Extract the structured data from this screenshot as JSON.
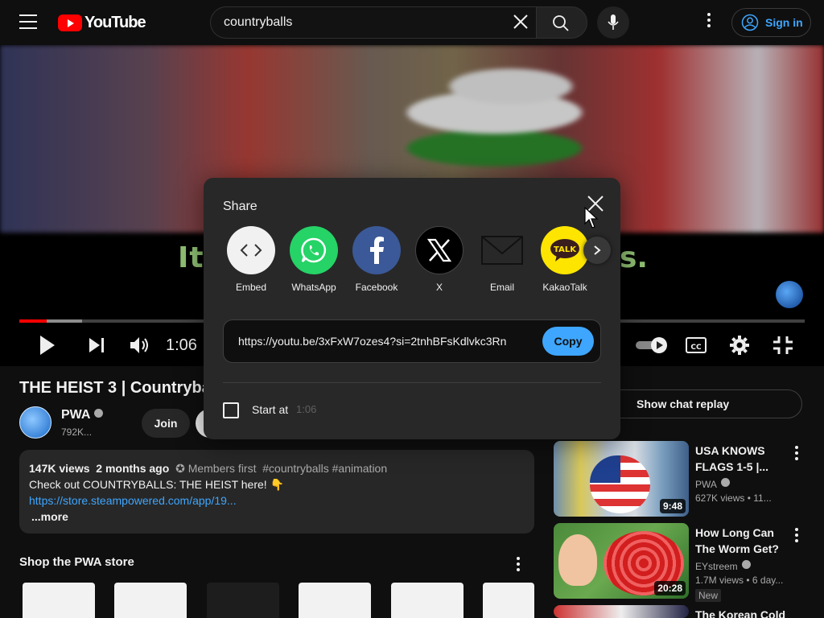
{
  "header": {
    "logo_text": "YouTube",
    "search_value": "countryballs",
    "signin_label": "Sign in"
  },
  "video": {
    "subtitle_left": "It",
    "subtitle_right": "s.",
    "time_current": "1:06",
    "progress_played": 0.035,
    "progress_buffered": 0.08
  },
  "watch": {
    "title": "THE HEIST 3 | Countryballs",
    "channel_name": "PWA",
    "subscriber_count": "792K...",
    "join_label": "Join",
    "description": {
      "views": "147K views",
      "age": "2 months ago",
      "members_label": "✪ Members first",
      "tags": "#countryballs #animation",
      "text": "Check out COUNTRYBALLS: THE HEIST here! 👇",
      "link": "https://store.steampowered.com/app/19...",
      "more_label": "...more"
    },
    "shop_title": "Shop the PWA store"
  },
  "sidebar": {
    "chat_replay_label": "Show chat replay",
    "recommendations": [
      {
        "title": "USA KNOWS FLAGS 1-5 |...",
        "channel": "PWA",
        "meta": "627K views • 11...",
        "duration": "9:48",
        "badge": ""
      },
      {
        "title": "How Long Can The Worm Get?",
        "channel": "EYstreem",
        "meta": "1.7M views • 6 day...",
        "duration": "20:28",
        "badge": "New"
      },
      {
        "title": "The Korean Cold",
        "channel": "",
        "meta": "",
        "duration": "",
        "badge": ""
      }
    ]
  },
  "share": {
    "title": "Share",
    "targets": [
      {
        "label": "Embed",
        "icon": "embed-icon",
        "bg": "#f1f1f1"
      },
      {
        "label": "WhatsApp",
        "icon": "whatsapp-icon",
        "bg": "#25d366"
      },
      {
        "label": "Facebook",
        "icon": "facebook-icon",
        "bg": "#3b5998"
      },
      {
        "label": "X",
        "icon": "x-icon",
        "bg": "#000000"
      },
      {
        "label": "Email",
        "icon": "email-icon",
        "bg": "#282828"
      },
      {
        "label": "KakaoTalk",
        "icon": "kakaotalk-icon",
        "bg": "#fee500"
      }
    ],
    "url": "https://youtu.be/3xFxW7ozes4?si=2tnhBFsKdlvkc3Rn",
    "copy_label": "Copy",
    "start_at_label": "Start at",
    "start_at_time": "1:06"
  },
  "colors": {
    "accent_blue": "#3ea6ff",
    "youtube_red": "#ff0000",
    "dialog_bg": "#282828"
  }
}
